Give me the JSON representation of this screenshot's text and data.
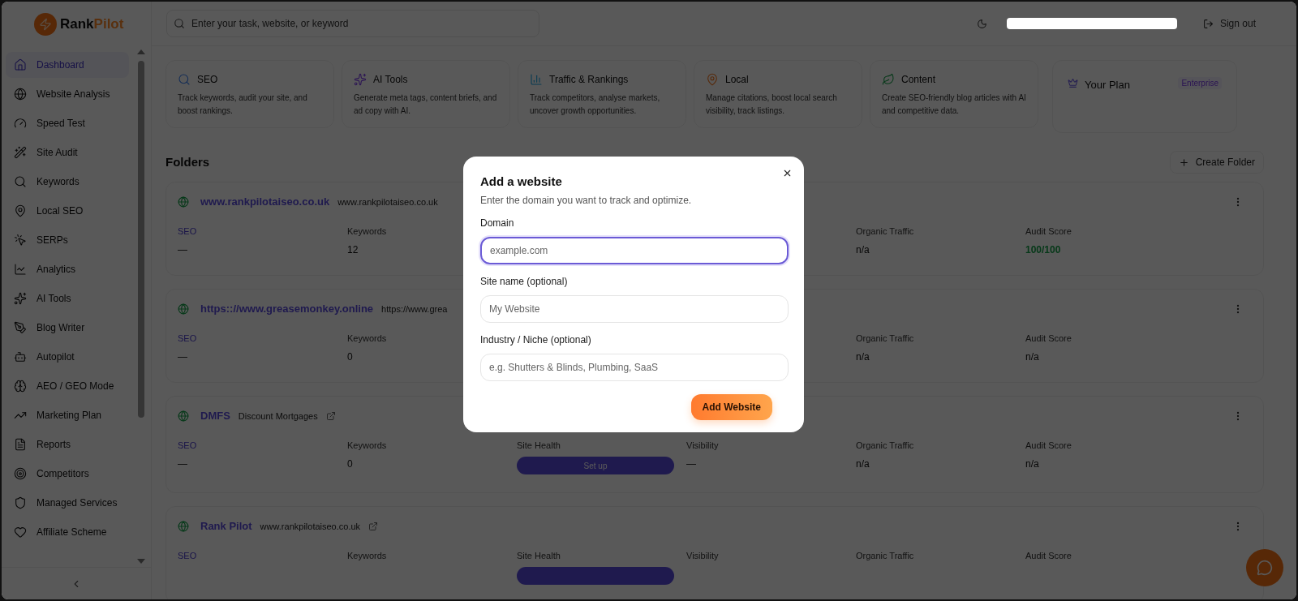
{
  "brand": {
    "part1": "Rank",
    "part2": "Pilot"
  },
  "search": {
    "placeholder": "Enter your task, website, or keyword"
  },
  "header": {
    "sign_out": "Sign out"
  },
  "sidebar": {
    "items": [
      {
        "label": "Dashboard",
        "selected": true
      },
      {
        "label": "Website Analysis",
        "selected": false
      },
      {
        "label": "Speed Test",
        "selected": false
      },
      {
        "label": "Site Audit",
        "selected": false
      },
      {
        "label": "Keywords",
        "selected": false
      },
      {
        "label": "Local SEO",
        "selected": false
      },
      {
        "label": "SERPs",
        "selected": false
      },
      {
        "label": "Analytics",
        "selected": false
      },
      {
        "label": "AI Tools",
        "selected": false
      },
      {
        "label": "Blog Writer",
        "selected": false
      },
      {
        "label": "Autopilot",
        "selected": false
      },
      {
        "label": "AEO / GEO Mode",
        "selected": false
      },
      {
        "label": "Marketing Plan",
        "selected": false
      },
      {
        "label": "Reports",
        "selected": false
      },
      {
        "label": "Competitors",
        "selected": false
      },
      {
        "label": "Managed Services",
        "selected": false
      },
      {
        "label": "Affiliate Scheme",
        "selected": false
      }
    ]
  },
  "features": [
    {
      "title": "SEO",
      "description": "Track keywords, audit your site, and boost rankings."
    },
    {
      "title": "AI Tools",
      "description": "Generate meta tags, content briefs, and ad copy with AI."
    },
    {
      "title": "Traffic & Rankings",
      "description": "Track competitors, analyse markets, uncover growth opportunities."
    },
    {
      "title": "Local",
      "description": "Manage citations, boost local search visibility, track listings."
    },
    {
      "title": "Content",
      "description": "Create SEO-friendly blog articles with AI and competitive data."
    }
  ],
  "plan": {
    "title": "Your Plan",
    "badge": "Enterprise"
  },
  "folders": {
    "title": "Folders",
    "create": "Create Folder",
    "items": [
      {
        "name": "www.rankpilotaiseo.co.uk",
        "url": "www.rankpilotaiseo.co.uk",
        "link_icon": false,
        "metrics": [
          {
            "label": "SEO",
            "value": "—",
            "kind": "text"
          },
          {
            "label": "Keywords",
            "value": "12",
            "kind": "text"
          },
          {
            "label": "Organic Traffic",
            "value": "n/a",
            "kind": "text"
          },
          {
            "label": "Audit Score",
            "value": "100/100",
            "kind": "score"
          }
        ]
      },
      {
        "name": "https:://www.greasemonkey.online",
        "url": "https://www.grea",
        "link_icon": false,
        "metrics": [
          {
            "label": "SEO",
            "value": "—",
            "kind": "text"
          },
          {
            "label": "Keywords",
            "value": "0",
            "kind": "text"
          },
          {
            "label": "Organic Traffic",
            "value": "n/a",
            "kind": "text"
          },
          {
            "label": "Audit Score",
            "value": "n/a",
            "kind": "text"
          }
        ]
      },
      {
        "name": "DMFS",
        "url": "Discount Mortgages",
        "link_icon": true,
        "metrics": [
          {
            "label": "SEO",
            "value": "—",
            "kind": "text"
          },
          {
            "label": "Keywords",
            "value": "0",
            "kind": "text"
          },
          {
            "label": "Site Health",
            "value": "Set up",
            "kind": "button"
          },
          {
            "label": "Visibility",
            "value": "—",
            "kind": "text"
          },
          {
            "label": "Organic Traffic",
            "value": "n/a",
            "kind": "text"
          },
          {
            "label": "Audit Score",
            "value": "n/a",
            "kind": "text"
          }
        ]
      },
      {
        "name": "Rank Pilot",
        "url": "www.rankpilotaiseo.co.uk",
        "link_icon": true,
        "metrics": [
          {
            "label": "SEO",
            "kind": "text"
          },
          {
            "label": "Keywords",
            "kind": "text"
          },
          {
            "label": "Site Health",
            "kind": "button"
          },
          {
            "label": "Visibility",
            "kind": "text"
          },
          {
            "label": "Organic Traffic",
            "kind": "text"
          },
          {
            "label": "Audit Score",
            "kind": "text"
          }
        ]
      }
    ]
  },
  "modal": {
    "title": "Add a website",
    "subtitle": "Enter the domain you want to track and optimize.",
    "fields": [
      {
        "label": "Domain",
        "placeholder": "example.com",
        "focused": true
      },
      {
        "label": "Site name (optional)",
        "placeholder": "My Website",
        "focused": false
      },
      {
        "label": "Industry / Niche (optional)",
        "placeholder": "e.g. Shutters & Blinds, Plumbing, SaaS",
        "focused": false
      }
    ],
    "submit": "Add Website"
  }
}
